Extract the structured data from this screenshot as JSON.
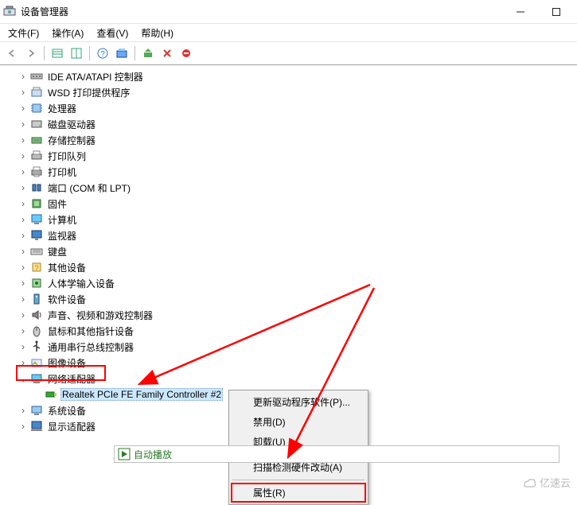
{
  "window": {
    "title": "设备管理器"
  },
  "menus": {
    "file": "文件(F)",
    "action": "操作(A)",
    "view": "查看(V)",
    "help": "帮助(H)"
  },
  "tree": {
    "items": [
      {
        "label": "IDE ATA/ATAPI 控制器"
      },
      {
        "label": "WSD 打印提供程序"
      },
      {
        "label": "处理器"
      },
      {
        "label": "磁盘驱动器"
      },
      {
        "label": "存储控制器"
      },
      {
        "label": "打印队列"
      },
      {
        "label": "打印机"
      },
      {
        "label": "端口 (COM 和 LPT)"
      },
      {
        "label": "固件"
      },
      {
        "label": "计算机"
      },
      {
        "label": "监视器"
      },
      {
        "label": "键盘"
      },
      {
        "label": "其他设备"
      },
      {
        "label": "人体学输入设备"
      },
      {
        "label": "软件设备"
      },
      {
        "label": "声音、视频和游戏控制器"
      },
      {
        "label": "鼠标和其他指针设备"
      },
      {
        "label": "通用串行总线控制器"
      },
      {
        "label": "图像设备"
      },
      {
        "label": "网络适配器",
        "expanded": true,
        "child": "Realtek PCIe FE Family Controller #2"
      },
      {
        "label": "系统设备"
      },
      {
        "label": "显示适配器"
      }
    ]
  },
  "context": {
    "updateDriver": "更新驱动程序软件(P)...",
    "disable": "禁用(D)",
    "uninstall": "卸载(U)",
    "scan": "扫描检测硬件改动(A)",
    "properties": "属性(R)"
  },
  "autoplay": "自动播放",
  "watermark": "亿速云"
}
